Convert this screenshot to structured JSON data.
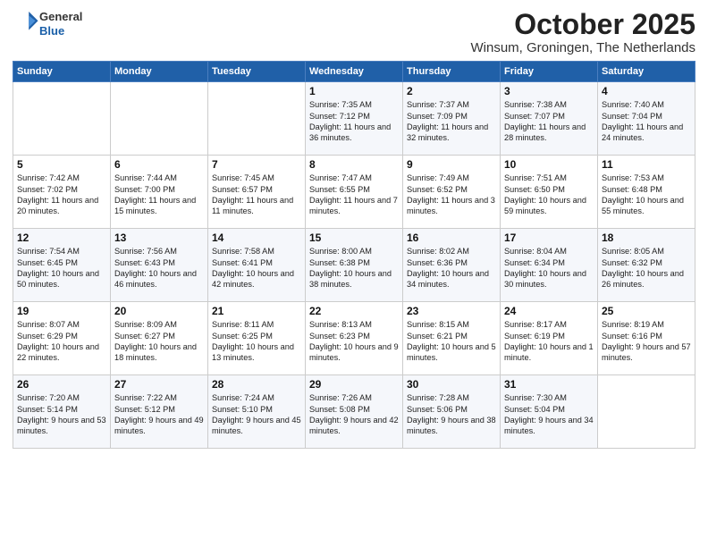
{
  "header": {
    "logo_line1": "General",
    "logo_line2": "Blue",
    "month": "October 2025",
    "location": "Winsum, Groningen, The Netherlands"
  },
  "days_of_week": [
    "Sunday",
    "Monday",
    "Tuesday",
    "Wednesday",
    "Thursday",
    "Friday",
    "Saturday"
  ],
  "weeks": [
    [
      {
        "day": "",
        "info": ""
      },
      {
        "day": "",
        "info": ""
      },
      {
        "day": "",
        "info": ""
      },
      {
        "day": "1",
        "info": "Sunrise: 7:35 AM\nSunset: 7:12 PM\nDaylight: 11 hours and 36 minutes."
      },
      {
        "day": "2",
        "info": "Sunrise: 7:37 AM\nSunset: 7:09 PM\nDaylight: 11 hours and 32 minutes."
      },
      {
        "day": "3",
        "info": "Sunrise: 7:38 AM\nSunset: 7:07 PM\nDaylight: 11 hours and 28 minutes."
      },
      {
        "day": "4",
        "info": "Sunrise: 7:40 AM\nSunset: 7:04 PM\nDaylight: 11 hours and 24 minutes."
      }
    ],
    [
      {
        "day": "5",
        "info": "Sunrise: 7:42 AM\nSunset: 7:02 PM\nDaylight: 11 hours and 20 minutes."
      },
      {
        "day": "6",
        "info": "Sunrise: 7:44 AM\nSunset: 7:00 PM\nDaylight: 11 hours and 15 minutes."
      },
      {
        "day": "7",
        "info": "Sunrise: 7:45 AM\nSunset: 6:57 PM\nDaylight: 11 hours and 11 minutes."
      },
      {
        "day": "8",
        "info": "Sunrise: 7:47 AM\nSunset: 6:55 PM\nDaylight: 11 hours and 7 minutes."
      },
      {
        "day": "9",
        "info": "Sunrise: 7:49 AM\nSunset: 6:52 PM\nDaylight: 11 hours and 3 minutes."
      },
      {
        "day": "10",
        "info": "Sunrise: 7:51 AM\nSunset: 6:50 PM\nDaylight: 10 hours and 59 minutes."
      },
      {
        "day": "11",
        "info": "Sunrise: 7:53 AM\nSunset: 6:48 PM\nDaylight: 10 hours and 55 minutes."
      }
    ],
    [
      {
        "day": "12",
        "info": "Sunrise: 7:54 AM\nSunset: 6:45 PM\nDaylight: 10 hours and 50 minutes."
      },
      {
        "day": "13",
        "info": "Sunrise: 7:56 AM\nSunset: 6:43 PM\nDaylight: 10 hours and 46 minutes."
      },
      {
        "day": "14",
        "info": "Sunrise: 7:58 AM\nSunset: 6:41 PM\nDaylight: 10 hours and 42 minutes."
      },
      {
        "day": "15",
        "info": "Sunrise: 8:00 AM\nSunset: 6:38 PM\nDaylight: 10 hours and 38 minutes."
      },
      {
        "day": "16",
        "info": "Sunrise: 8:02 AM\nSunset: 6:36 PM\nDaylight: 10 hours and 34 minutes."
      },
      {
        "day": "17",
        "info": "Sunrise: 8:04 AM\nSunset: 6:34 PM\nDaylight: 10 hours and 30 minutes."
      },
      {
        "day": "18",
        "info": "Sunrise: 8:05 AM\nSunset: 6:32 PM\nDaylight: 10 hours and 26 minutes."
      }
    ],
    [
      {
        "day": "19",
        "info": "Sunrise: 8:07 AM\nSunset: 6:29 PM\nDaylight: 10 hours and 22 minutes."
      },
      {
        "day": "20",
        "info": "Sunrise: 8:09 AM\nSunset: 6:27 PM\nDaylight: 10 hours and 18 minutes."
      },
      {
        "day": "21",
        "info": "Sunrise: 8:11 AM\nSunset: 6:25 PM\nDaylight: 10 hours and 13 minutes."
      },
      {
        "day": "22",
        "info": "Sunrise: 8:13 AM\nSunset: 6:23 PM\nDaylight: 10 hours and 9 minutes."
      },
      {
        "day": "23",
        "info": "Sunrise: 8:15 AM\nSunset: 6:21 PM\nDaylight: 10 hours and 5 minutes."
      },
      {
        "day": "24",
        "info": "Sunrise: 8:17 AM\nSunset: 6:19 PM\nDaylight: 10 hours and 1 minute."
      },
      {
        "day": "25",
        "info": "Sunrise: 8:19 AM\nSunset: 6:16 PM\nDaylight: 9 hours and 57 minutes."
      }
    ],
    [
      {
        "day": "26",
        "info": "Sunrise: 7:20 AM\nSunset: 5:14 PM\nDaylight: 9 hours and 53 minutes."
      },
      {
        "day": "27",
        "info": "Sunrise: 7:22 AM\nSunset: 5:12 PM\nDaylight: 9 hours and 49 minutes."
      },
      {
        "day": "28",
        "info": "Sunrise: 7:24 AM\nSunset: 5:10 PM\nDaylight: 9 hours and 45 minutes."
      },
      {
        "day": "29",
        "info": "Sunrise: 7:26 AM\nSunset: 5:08 PM\nDaylight: 9 hours and 42 minutes."
      },
      {
        "day": "30",
        "info": "Sunrise: 7:28 AM\nSunset: 5:06 PM\nDaylight: 9 hours and 38 minutes."
      },
      {
        "day": "31",
        "info": "Sunrise: 7:30 AM\nSunset: 5:04 PM\nDaylight: 9 hours and 34 minutes."
      },
      {
        "day": "",
        "info": ""
      }
    ]
  ]
}
